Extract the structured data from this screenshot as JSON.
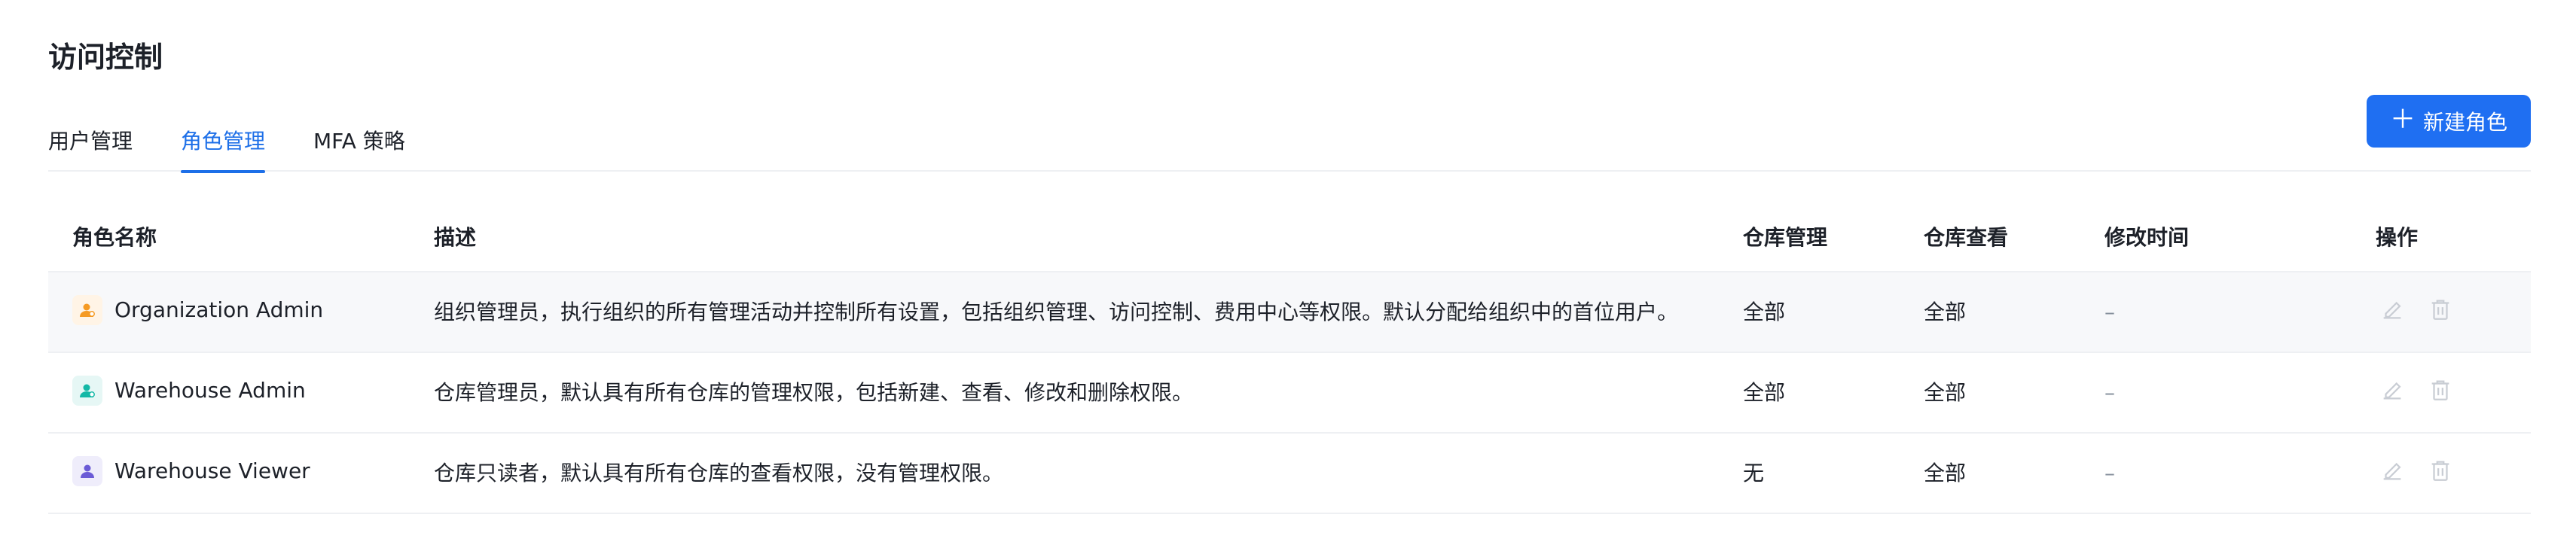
{
  "header": {
    "title": "访问控制"
  },
  "tabs": [
    {
      "label": "用户管理",
      "active": false
    },
    {
      "label": "角色管理",
      "active": true
    },
    {
      "label": "MFA 策略",
      "active": false
    }
  ],
  "toolbar": {
    "new_role_label": "新建角色",
    "plus_icon": "plus-icon"
  },
  "table": {
    "columns": [
      "角色名称",
      "描述",
      "仓库管理",
      "仓库查看",
      "修改时间",
      "操作"
    ],
    "rows": [
      {
        "name": "Organization Admin",
        "icon": "user-admin-icon",
        "icon_color": "#f59a23",
        "icon_bg": "#fff4e6",
        "description": "组织管理员，执行组织的所有管理活动并控制所有设置，包括组织管理、访问控制、费用中心等权限。默认分配给组织中的首位用户。",
        "warehouse_manage": "全部",
        "warehouse_view": "全部",
        "modified": "–"
      },
      {
        "name": "Warehouse Admin",
        "icon": "user-shield-icon",
        "icon_color": "#14b8a6",
        "icon_bg": "#e6f7f5",
        "description": "仓库管理员，默认具有所有仓库的管理权限，包括新建、查看、修改和删除权限。",
        "warehouse_manage": "全部",
        "warehouse_view": "全部",
        "modified": "–"
      },
      {
        "name": "Warehouse Viewer",
        "icon": "user-view-icon",
        "icon_color": "#6b5bd6",
        "icon_bg": "#efedfb",
        "description": "仓库只读者，默认具有所有仓库的查看权限，没有管理权限。",
        "warehouse_manage": "无",
        "warehouse_view": "全部",
        "modified": "–"
      }
    ]
  },
  "colors": {
    "accent": "#1d6fe8",
    "button": "#1f6ff2",
    "disabled_icon": "#c9cdd4"
  }
}
